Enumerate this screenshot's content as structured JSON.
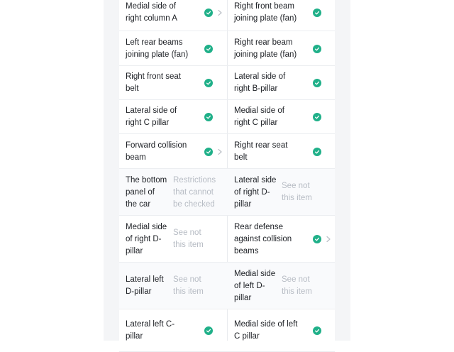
{
  "rows": [
    {
      "left": {
        "label": "Medial side of\nright column A",
        "status": "check",
        "chevron": true
      },
      "right": {
        "label": "Right front beam\njoining plate (fan)",
        "status": "check",
        "chevron": false
      }
    },
    {
      "left": {
        "label": "Left rear beams\njoining plate (fan)",
        "status": "check",
        "chevron": false
      },
      "right": {
        "label": "Right rear beam\njoining plate (fan)",
        "status": "check",
        "chevron": false
      }
    },
    {
      "left": {
        "label": "Right front seat\nbelt",
        "status": "check",
        "chevron": false
      },
      "right": {
        "label": "Lateral side of\nright B-pillar",
        "status": "check",
        "chevron": false
      }
    },
    {
      "left": {
        "label": "Lateral side of\nright C pillar",
        "status": "check",
        "chevron": false
      },
      "right": {
        "label": "Medial side of\nright C pillar",
        "status": "check",
        "chevron": false
      }
    },
    {
      "left": {
        "label": "Forward collision\nbeam",
        "status": "check",
        "chevron": true
      },
      "right": {
        "label": "Right rear seat\nbelt",
        "status": "check",
        "chevron": false
      }
    },
    {
      "left": {
        "label": "The bottom\npanel of\nthe car",
        "status": "note",
        "note": "Restrictions\nthat cannot\nbe checked"
      },
      "right": {
        "label": "Lateral side\nof right D-\npillar",
        "status": "note",
        "note": "See not\nthis item"
      }
    },
    {
      "left": {
        "label": "Medial side\nof right D-\npillar",
        "status": "note",
        "note": "See not\nthis item"
      },
      "right": {
        "label": "Rear defense\nagainst collision\nbeams",
        "status": "check",
        "chevron": true
      }
    },
    {
      "left": {
        "label": "Lateral left\nD-pillar",
        "status": "note",
        "note": "See not\nthis item"
      },
      "right": {
        "label": "Medial side\nof left D-\npillar",
        "status": "note",
        "note": "See not\nthis item"
      }
    },
    {
      "left": {
        "label": "Lateral left C-\npillar",
        "status": "check",
        "chevron": false
      },
      "right": {
        "label": "Medial side of left\nC pillar",
        "status": "check",
        "chevron": false
      }
    }
  ],
  "colors": {
    "check": "#20b089",
    "note": "#b7bcc4",
    "text": "#1c1f24"
  },
  "icons": {
    "check": "check-circle-icon",
    "chevron": "chevron-right-icon"
  }
}
